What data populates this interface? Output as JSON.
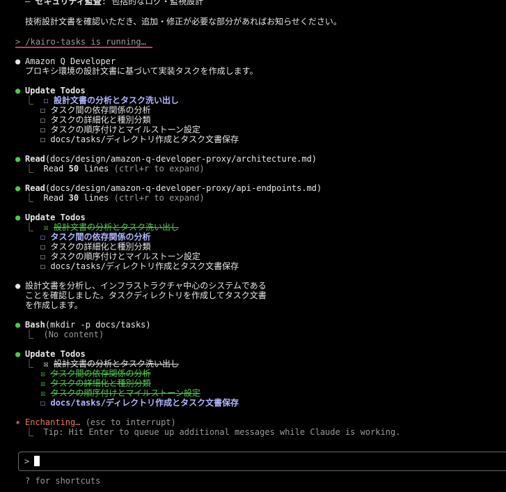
{
  "top": {
    "security_line_prefix": "– ",
    "security_line_bold": "セキュリティ監査",
    "security_line_rest": ": 包括的なログ・監視設計",
    "confirm_line": "技術設計文書を確認いただき、追加・修正が必要な部分があればお知らせください。"
  },
  "command": {
    "text": "> /kairo-tasks is running…"
  },
  "agent": {
    "bullet": "●",
    "name": "Amazon Q Developer",
    "description": "プロキシ環境の設計文書に基づいて実装タスクを作成します。"
  },
  "todos1": {
    "title": "Update Todos",
    "items": [
      {
        "box": "☐",
        "text": "設計文書の分析とタスク洗い出し"
      },
      {
        "box": "☐",
        "text": "タスク間の依存関係の分析"
      },
      {
        "box": "☐",
        "text": "タスクの詳細化と種別分類"
      },
      {
        "box": "☐",
        "text": "タスクの順序付けとマイルストーン設定"
      },
      {
        "box": "☐",
        "text": "docs/tasks/ディレクトリ作成とタスク文書保存"
      }
    ]
  },
  "read1": {
    "tool": "Read",
    "arg": "(docs/design/amazon-q-developer-proxy/architecture.md)",
    "result_prefix": "Read ",
    "result_count": "50",
    "result_suffix": " lines",
    "hint": " (ctrl+r to expand)"
  },
  "read2": {
    "tool": "Read",
    "arg": "(docs/design/amazon-q-developer-proxy/api-endpoints.md)",
    "result_prefix": "Read ",
    "result_count": "30",
    "result_suffix": " lines",
    "hint": " (ctrl+r to expand)"
  },
  "todos2": {
    "title": "Update Todos",
    "items": [
      {
        "box": "☒",
        "text": "設計文書の分析とタスク洗い出し"
      },
      {
        "box": "☐",
        "text": "タスク間の依存関係の分析"
      },
      {
        "box": "☐",
        "text": "タスクの詳細化と種別分類"
      },
      {
        "box": "☐",
        "text": "タスクの順序付けとマイルストーン設定"
      },
      {
        "box": "☐",
        "text": "docs/tasks/ディレクトリ作成とタスク文書保存"
      }
    ]
  },
  "message": {
    "lines": [
      "設計文書を分析し、インフラストラクチャ中心のシステムである",
      "ことを確認しました。タスクディレクトリを作成してタスク文書",
      "を作成します。"
    ]
  },
  "bash": {
    "tool": "Bash",
    "arg": "(mkdir -p docs/tasks)",
    "result": "(No content)"
  },
  "todos3": {
    "title": "Update Todos",
    "items": [
      {
        "box": "☒",
        "text": "設計文書の分析とタスク洗い出し"
      },
      {
        "box": "☒",
        "text": "タスク間の依存関係の分析"
      },
      {
        "box": "☒",
        "text": "タスクの詳細化と種別分類"
      },
      {
        "box": "☒",
        "text": "タスクの順序付けとマイルストーン設定"
      },
      {
        "box": "☐",
        "text": "docs/tasks/ディレクトリ作成とタスク文書保存"
      }
    ]
  },
  "status": {
    "star": "✶",
    "word": "Enchanting…",
    "hint": " (esc to interrupt)",
    "tip": "Tip: Hit Enter to queue up additional messages while Claude is working."
  },
  "input": {
    "prompt": ">",
    "value": ""
  },
  "footer": {
    "shortcuts": "? for shortcuts"
  },
  "glyphs": {
    "corner": "⎿"
  },
  "colors": {
    "background": "#000000",
    "text": "#e6e6e6",
    "green": "#4ec94e",
    "active_todo": "#b0b6ff",
    "status": "#e8785a",
    "underline": "#d9336b"
  }
}
